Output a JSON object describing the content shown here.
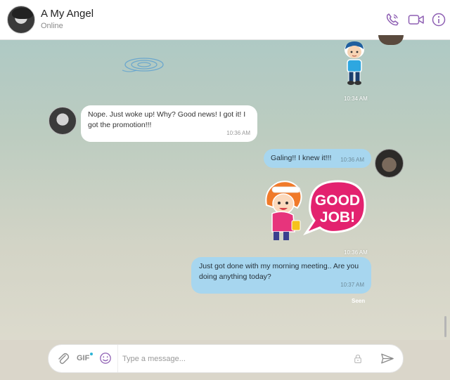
{
  "header": {
    "contact_name": "A My Angel",
    "status": "Online"
  },
  "messages": [
    {
      "type": "sticker",
      "direction": "outgoing",
      "sticker": "boy-character",
      "time": "10:34 AM"
    },
    {
      "type": "text",
      "direction": "incoming",
      "text": "Nope. Just woke up! Why? Good news! I got it! I got the promotion!!!",
      "time": "10:36 AM"
    },
    {
      "type": "text",
      "direction": "outgoing",
      "text": "Galing!! I knew it!!!",
      "time": "10:36 AM"
    },
    {
      "type": "sticker",
      "direction": "outgoing",
      "sticker": "good-job-girl",
      "sticker_text_1": "GOOD",
      "sticker_text_2": "JOB!",
      "time": "10:36 AM"
    },
    {
      "type": "text",
      "direction": "outgoing",
      "text": "Just got done with my morning meeting.. Are you doing anything today?",
      "time": "10:37 AM",
      "receipt": "Seen"
    }
  ],
  "composer": {
    "gif_label": "GIF",
    "placeholder": "Type a message..."
  },
  "colors": {
    "accent": "#8e5fb3",
    "outgoing_bubble": "#a7d6ef",
    "incoming_bubble": "#ffffff"
  },
  "icons": [
    "phone-icon",
    "video-icon",
    "info-icon",
    "attachment-icon",
    "emoji-icon",
    "lock-icon",
    "send-icon"
  ]
}
